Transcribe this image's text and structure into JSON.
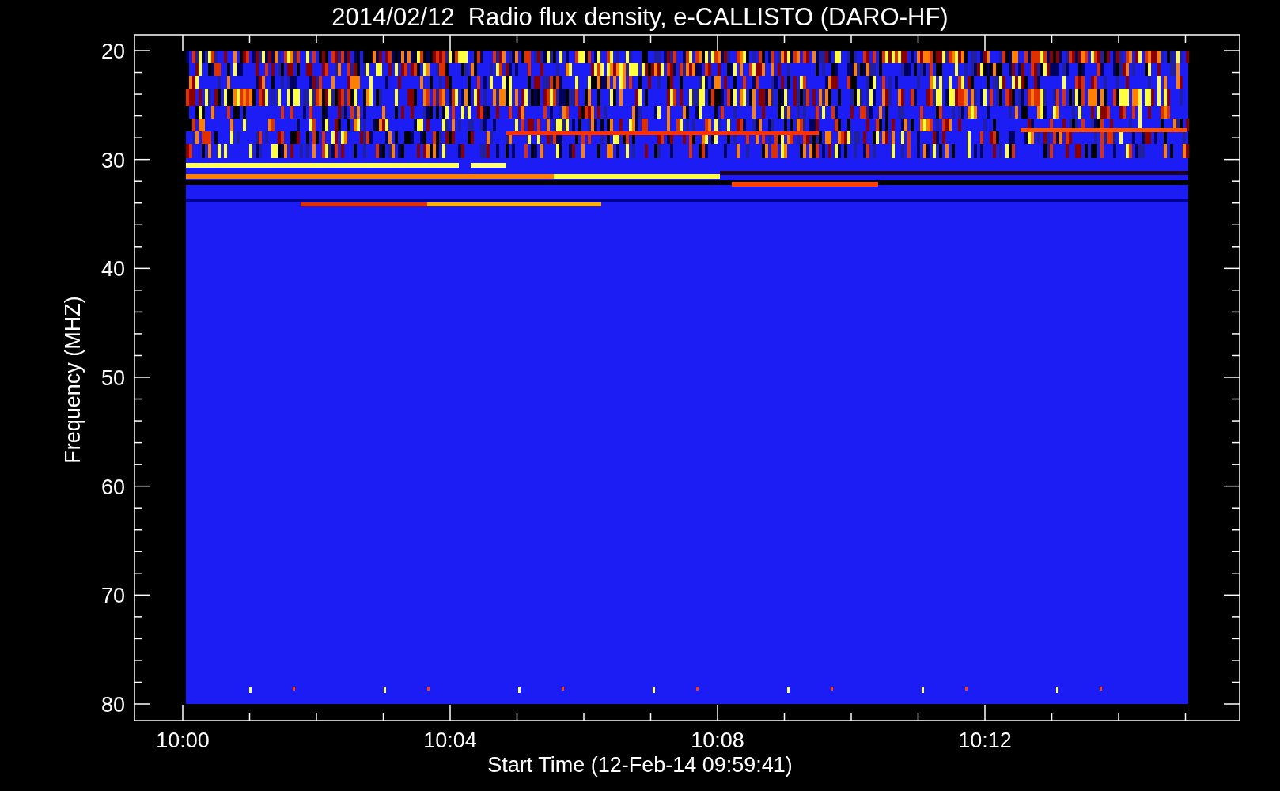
{
  "title": "2014/02/12  Radio flux density, e-CALLISTO (DARO-HF)",
  "y_axis": {
    "label": "Frequency (MHZ)",
    "ticks": [
      "20",
      "30",
      "40",
      "50",
      "60",
      "70",
      "80"
    ]
  },
  "x_axis": {
    "label": "Start Time (12-Feb-14 09:59:41)",
    "ticks": [
      "10:00",
      "10:04",
      "10:08",
      "10:12"
    ]
  }
}
